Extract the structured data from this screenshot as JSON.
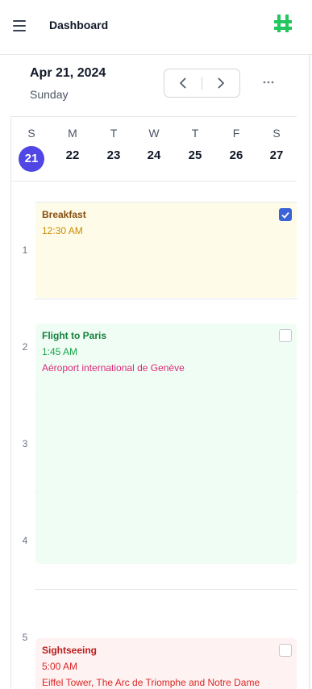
{
  "header": {
    "title": "Dashboard",
    "logo_color": "#22c55e",
    "menu_icon": "hamburger-icon"
  },
  "date_bar": {
    "date": "Apr 21, 2024",
    "weekday": "Sunday",
    "prev_icon": "chevron-left-icon",
    "next_icon": "chevron-right-icon",
    "more_icon": "ellipsis-icon"
  },
  "week": {
    "days": [
      {
        "letter": "S",
        "date": "21",
        "selected": true
      },
      {
        "letter": "M",
        "date": "22",
        "selected": false
      },
      {
        "letter": "T",
        "date": "23",
        "selected": false
      },
      {
        "letter": "W",
        "date": "24",
        "selected": false
      },
      {
        "letter": "T",
        "date": "25",
        "selected": false
      },
      {
        "letter": "F",
        "date": "26",
        "selected": false
      },
      {
        "letter": "S",
        "date": "27",
        "selected": false
      }
    ],
    "accent": "#4f46e5"
  },
  "hours": [
    "1",
    "2",
    "3",
    "4",
    "5"
  ],
  "events": [
    {
      "title": "Breakfast",
      "time": "12:30 AM",
      "location": "",
      "checked": true,
      "color": "#fefce8"
    },
    {
      "title": "Flight to Paris",
      "time": "1:45 AM",
      "location": "Aéroport international de Genève",
      "checked": false,
      "color": "#f0fdf4"
    },
    {
      "title": "Sightseeing",
      "time": "5:00 AM",
      "location": "Eiffel Tower, The Arc de Triomphe and Notre Dame",
      "checked": false,
      "color": "#fef2f2"
    }
  ]
}
